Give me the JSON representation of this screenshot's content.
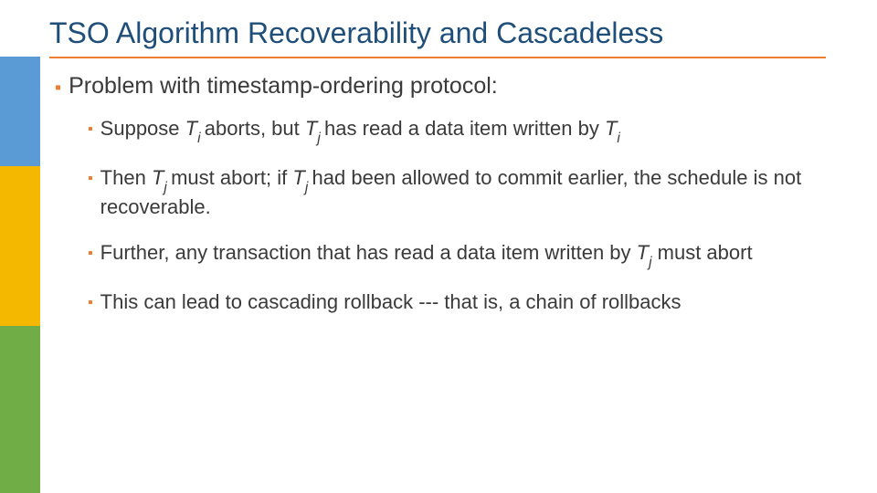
{
  "title": "TSO Algorithm Recoverability and Cascadeless",
  "bullets": {
    "main": "Problem with timestamp-ordering protocol:",
    "sub1": {
      "pre": "Suppose ",
      "t1": "T",
      "s1": "i ",
      "mid1": "aborts, but ",
      "t2": "T",
      "s2": "j ",
      "mid2": "has read a data item written by  ",
      "t3": "T",
      "s3": "i"
    },
    "sub2": {
      "pre": "Then ",
      "t1": "T",
      "s1": "j ",
      "mid1": "must abort; if ",
      "t2": "T",
      "s2": "j ",
      "post": "had been allowed to commit earlier, the schedule is not recoverable."
    },
    "sub3": {
      "pre": "Further, any transaction that has read a data item written by ",
      "t1": "T",
      "s1": "j",
      "post": " must abort"
    },
    "sub4": "This can lead to cascading rollback --- that is, a chain of rollbacks"
  }
}
